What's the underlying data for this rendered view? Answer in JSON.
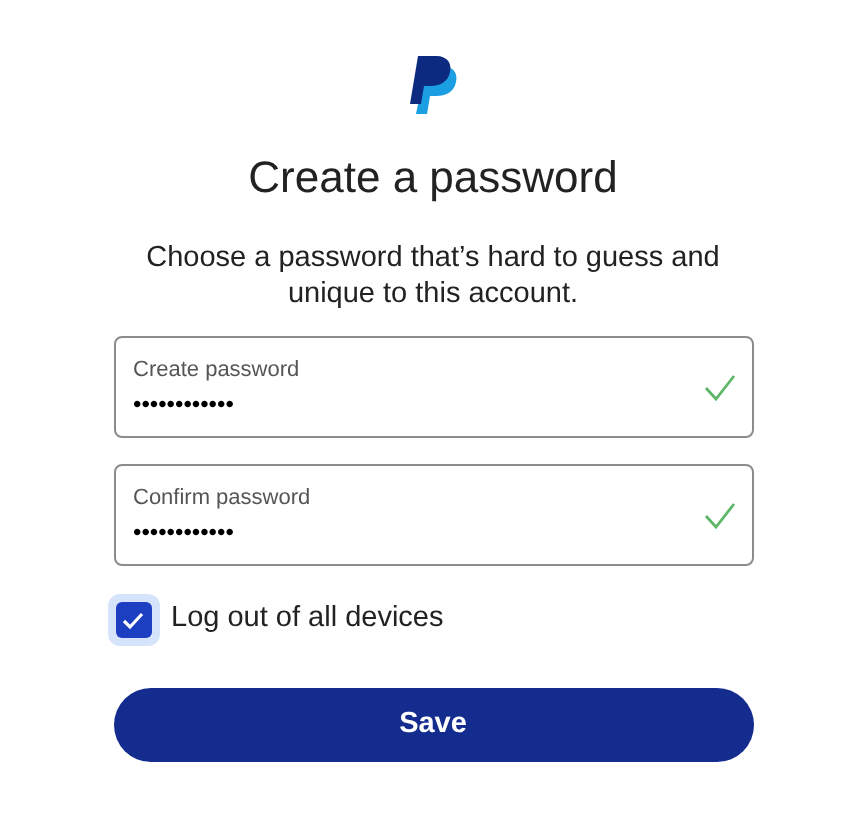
{
  "title": "Create a password",
  "subtitle": "Choose a password that’s hard to guess and unique to this account.",
  "fields": [
    {
      "label": "Create password",
      "value": "••••••••••••",
      "valid": true
    },
    {
      "label": "Confirm password",
      "value": "••••••••••••",
      "valid": true
    }
  ],
  "checkbox": {
    "label": "Log out of all devices",
    "checked": true
  },
  "button": "Save"
}
